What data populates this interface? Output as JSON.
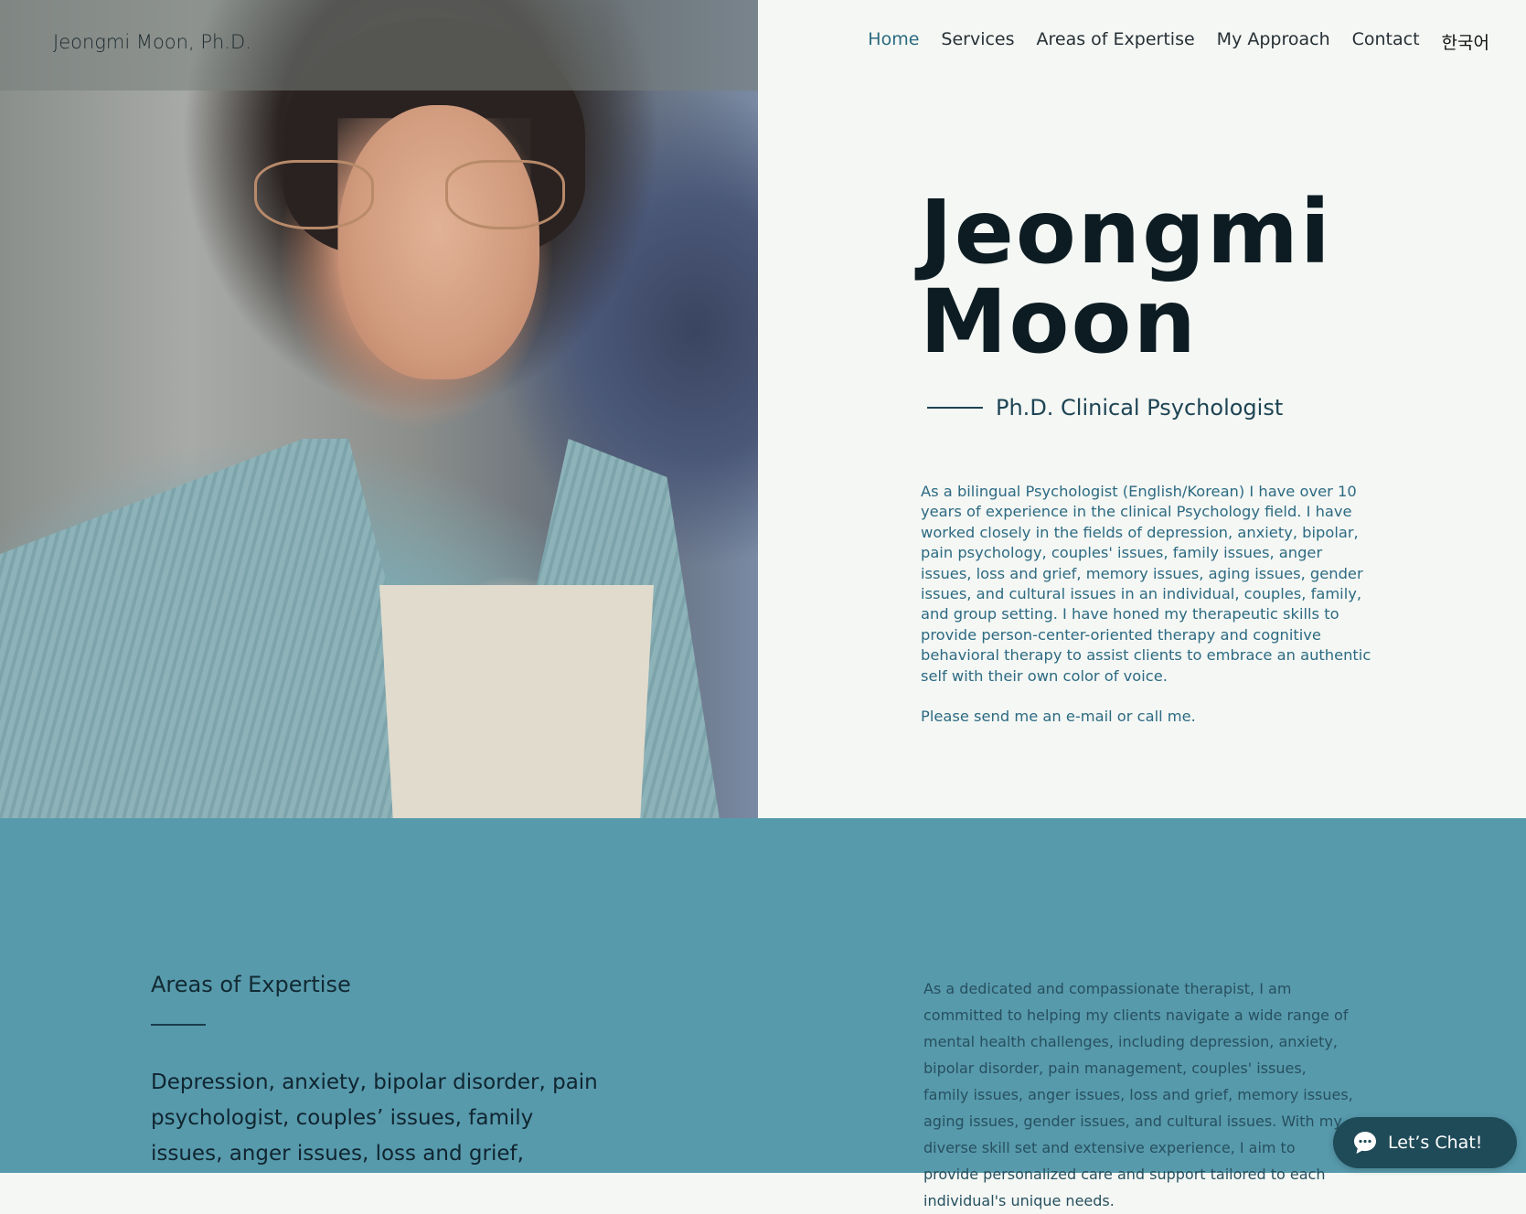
{
  "header": {
    "logo": "Jeongmi Moon, Ph.D.",
    "nav": [
      "Home",
      "Services",
      "Areas of Expertise",
      "My Approach",
      "Contact",
      "한국어"
    ]
  },
  "hero": {
    "name_line1": "Jeongmi",
    "name_line2": "Moon",
    "subtitle": "Ph.D. Clinical Psychologist",
    "bio_paragraph": "As a bilingual Psychologist (English/Korean) I have over 10 years of experience in the clinical Psychology field. I have worked closely in the fields of depression, anxiety, bipolar, pain psychology, couples' issues, family issues, anger issues, loss and grief, memory issues, aging issues, gender issues, and cultural issues in an individual, couples, family, and group setting. I have honed my therapeutic skills to provide person-center-oriented therapy and cognitive behavioral therapy to assist clients to embrace an authentic self with their own color of voice.",
    "contact_line": "Please send me an e-mail or call me."
  },
  "expertise": {
    "heading": "Areas of Expertise",
    "list_text": "Depression, anxiety, bipolar disorder, pain psychologist, couples’ issues, family issues, anger issues, loss and grief,",
    "body": "As a dedicated and compassionate therapist, I am committed to helping my clients navigate a wide range of mental health challenges, including depression, anxiety, bipolar disorder, pain management, couples' issues, family issues, anger issues, loss and grief, memory issues, aging issues, gender issues, and cultural issues. With my diverse skill set and extensive experience, I aim to provide personalized care and support tailored to each individual's unique needs."
  },
  "chat": {
    "label": "Let’s Chat!"
  },
  "colors": {
    "page_bg": "#f4f7f4",
    "accent_nav": "#2b6a7f",
    "section_bg": "#579aac",
    "chat_bg": "#1f4a58"
  }
}
